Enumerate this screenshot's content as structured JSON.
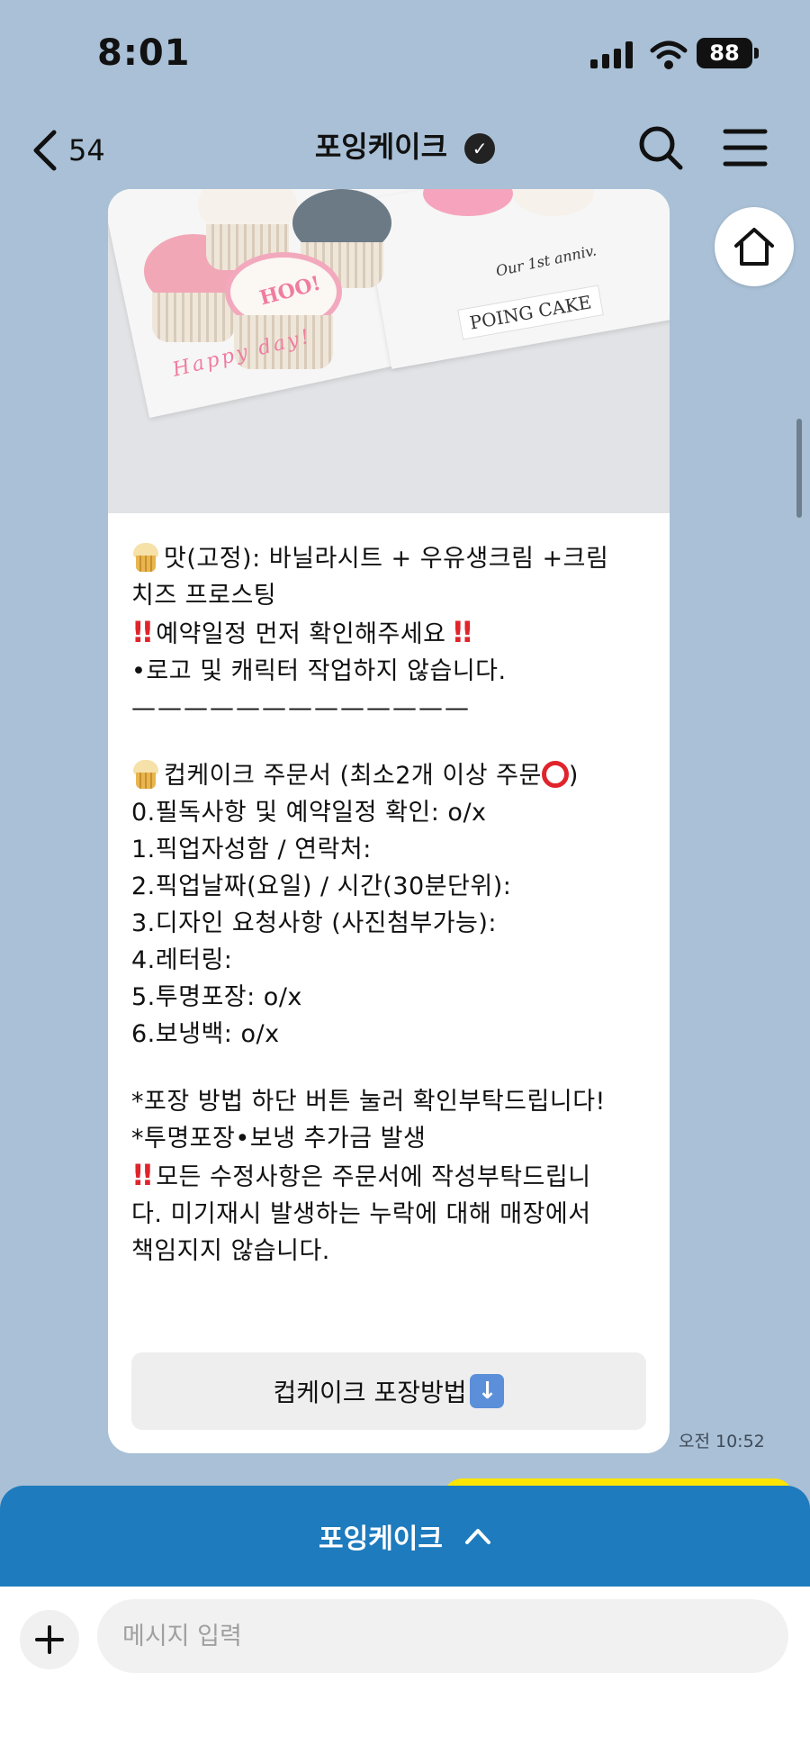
{
  "status_bar": {
    "time": "8:01",
    "battery": "88"
  },
  "nav": {
    "back_count": "54",
    "title": "포잉케이크"
  },
  "card": {
    "image": {
      "board_text_1": "Our 1st anniv.",
      "board_text_2": "POING CAKE",
      "plaque_text": "HOO!",
      "board_script": "Happy day!"
    },
    "lines": [
      "맛(고정): 바닐라시트 + 우유생크림 +크림",
      "치즈 프로스팅",
      "예약일정 먼저 확인해주세요",
      "•로고 및 캐릭터 작업하지 않습니다.",
      "—————————————",
      "컵케이크 주문서 (최소2개 이상 주문",
      "0.필독사항 및 예약일정 확인: o/x",
      "1.픽업자성함 / 연락처:",
      "2.픽업날짜(요일) / 시간(30분단위):",
      "3.디자인 요청사항 (사진첨부가능):",
      "4.레터링:",
      "5.투명포장: o/x",
      "6.보냉백: o/x",
      "*포장 방법 하단 버튼 눌러 확인부탁드립니다!",
      "*투명포장•보냉 추가금 발생",
      "모든 수정사항은 주문서에 작성부탁드립니",
      "다. 미기재시 발생하는 누락에 대해 매장에서",
      "책임지지 않습니다."
    ],
    "button_label": "컵케이크 포장방법"
  },
  "timestamp": "오전 10:52",
  "bottom_panel": {
    "label": "포잉케이크"
  },
  "input": {
    "placeholder": "메시지 입력"
  },
  "colors": {
    "background": "#a9c0d6",
    "panel": "#1e7bbd",
    "alert_red": "#e0242c",
    "yellow_bubble": "#fee500"
  },
  "icons": [
    "back-chevron-icon",
    "verified-icon",
    "search-icon",
    "menu-icon",
    "home-icon",
    "cupcake-emoji-icon",
    "double-exclamation-icon",
    "red-circle-icon",
    "down-arrow-icon",
    "chevron-up-icon",
    "plus-icon"
  ]
}
